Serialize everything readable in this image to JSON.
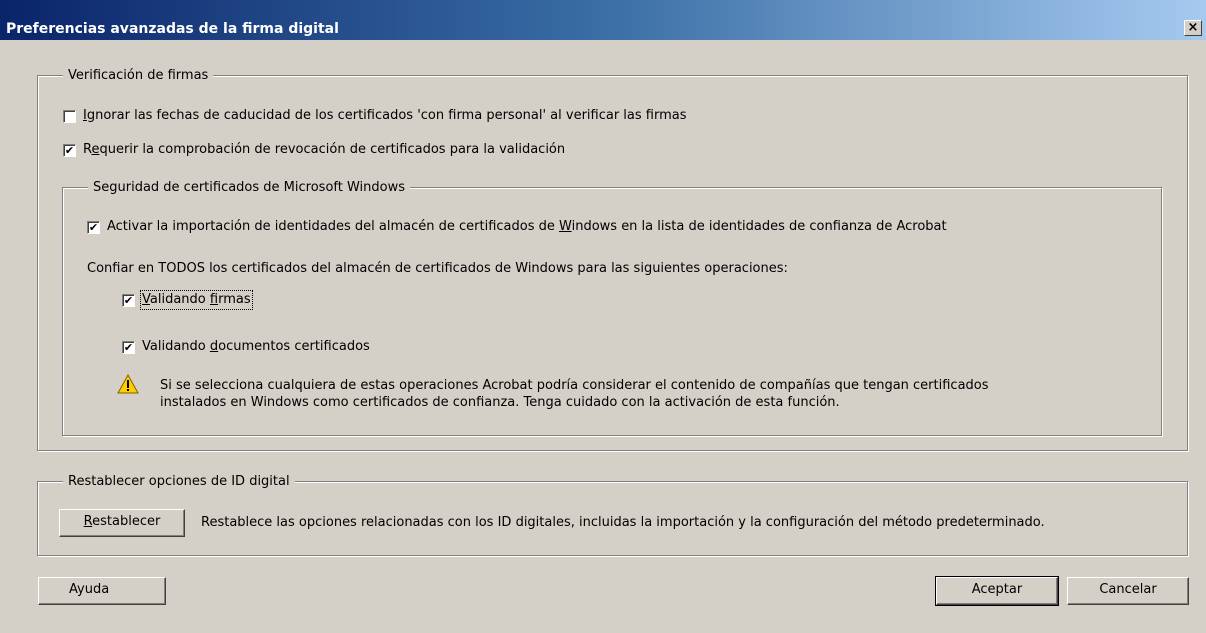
{
  "window": {
    "title": "Preferencias avanzadas de la firma digital",
    "close_glyph": "×"
  },
  "verify_group": {
    "legend": "Verificación de firmas",
    "ignore_expiry": {
      "label_pre": "",
      "label_u": "I",
      "label_post": "gnorar las fechas de caducidad de los certificados 'con firma personal' al verificar las firmas",
      "checked": false
    },
    "require_revocation": {
      "label_pre": "R",
      "label_u": "e",
      "label_post": "querir la comprobación de revocación de certificados para la validación",
      "checked": true
    }
  },
  "windows_group": {
    "legend": "Seguridad de certificados de Microsoft Windows",
    "import_identities": {
      "label_pre": "Activar la importación de identidades del almacén de certificados de ",
      "label_u": "W",
      "label_post": "indows en la lista de identidades de confianza de Acrobat",
      "checked": true
    },
    "trust_text": "Confiar en TODOS los certificados del almacén de certificados de Windows para las siguientes operaciones:",
    "validating_signatures": {
      "label_pre": "",
      "label_u": "V",
      "label_mid": "alidando ",
      "label_u2": "f",
      "label_post": "irmas",
      "checked": true
    },
    "validating_documents": {
      "label_pre": "Validando ",
      "label_u": "d",
      "label_post": "ocumentos certificados",
      "checked": true
    },
    "warning_line1": "Si se selecciona cualquiera de estas operaciones Acrobat podría considerar el contenido de compañías que tengan certificados",
    "warning_line2": "instalados en Windows como certificados de confianza. Tenga cuidado con la activación de esta función.",
    "warning_icon": "warning-triangle-icon"
  },
  "reset_group": {
    "legend": "Restablecer opciones de ID digital",
    "button_u": "R",
    "button_rest": "establecer",
    "description": "Restablece las opciones relacionadas con los ID digitales, incluidas la importación y la configuración del método predeterminado."
  },
  "footer": {
    "help": "Ayuda",
    "ok": "Aceptar",
    "cancel": "Cancelar"
  },
  "check_glyph": "✔",
  "colors": {
    "title_start": "#0a246a",
    "title_end": "#a6caf0",
    "face": "#d4d0c8",
    "warning": "#ffcc00"
  }
}
